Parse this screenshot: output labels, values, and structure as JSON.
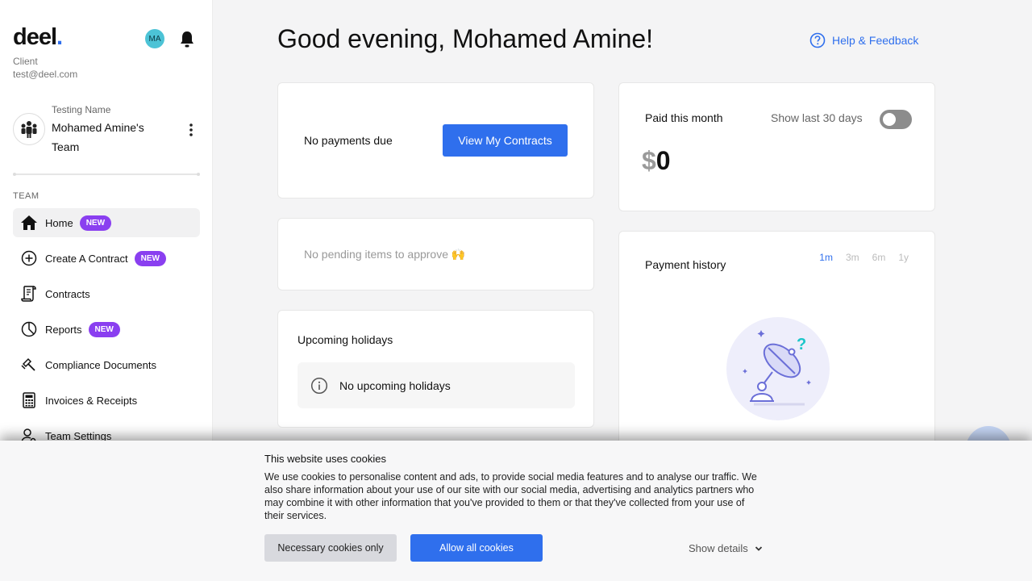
{
  "sidebar": {
    "logo_text": "deel",
    "logo_dot": ".",
    "avatar_initials": "MA",
    "role": "Client",
    "email": "test@deel.com",
    "team": {
      "sub_label": "Testing Name",
      "name": "Mohamed Amine's Team"
    },
    "section_label": "TEAM",
    "items": [
      {
        "label": "Home",
        "icon": "home-icon",
        "badge": "NEW",
        "active": true
      },
      {
        "label": "Create A Contract",
        "icon": "plus-circle-icon",
        "badge": "NEW"
      },
      {
        "label": "Contracts",
        "icon": "contract-icon"
      },
      {
        "label": "Reports",
        "icon": "pie-chart-icon",
        "badge": "NEW"
      },
      {
        "label": "Compliance Documents",
        "icon": "gavel-icon"
      },
      {
        "label": "Invoices & Receipts",
        "icon": "calculator-icon"
      },
      {
        "label": "Team Settings",
        "icon": "user-settings-icon"
      }
    ]
  },
  "header": {
    "greeting": "Good evening, Mohamed Amine!",
    "help_label": "Help & Feedback"
  },
  "payments_card": {
    "text": "No payments due",
    "button_label": "View My Contracts"
  },
  "approve_card": {
    "text": "No pending items to approve 🙌"
  },
  "holidays_card": {
    "title": "Upcoming holidays",
    "empty_text": "No upcoming holidays"
  },
  "paid_card": {
    "title": "Paid this month",
    "toggle_label": "Show last 30 days",
    "toggle_on": false,
    "currency": "$",
    "amount": "0"
  },
  "history_card": {
    "title": "Payment history",
    "ranges": [
      "1m",
      "3m",
      "6m",
      "1y"
    ],
    "active_range": "1m"
  },
  "cookie_banner": {
    "title": "This website uses cookies",
    "body": "We use cookies to personalise content and ads, to provide social media features and to analyse our traffic. We also share information about your use of our site with our social media, advertising and analytics partners who may combine it with other information that you've provided to them or that they've collected from your use of their services.",
    "necessary_label": "Necessary cookies only",
    "allow_label": "Allow all cookies",
    "details_label": "Show details"
  },
  "colors": {
    "accent": "#2f6fed",
    "badge": "#8a3ff0",
    "avatar": "#4cc3d6"
  }
}
